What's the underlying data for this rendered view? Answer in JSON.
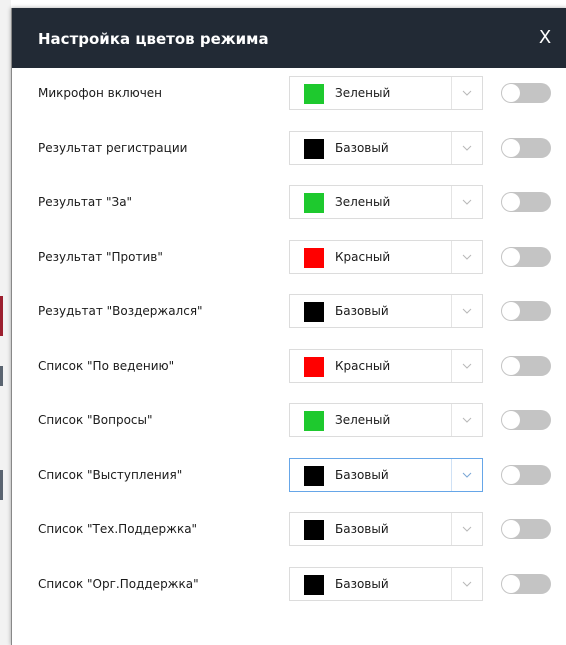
{
  "dialog": {
    "title": "Настройка цветов режима",
    "close_label": "X"
  },
  "colors": {
    "green": "#1ec92e",
    "black": "#000000",
    "red": "#ff0000",
    "header_bg": "#222a35",
    "focus_border": "#66a6e8",
    "toggle_off": "#c4c4c4"
  },
  "settings": [
    {
      "label": "Микрофон включен",
      "color_name": "Зеленый",
      "swatch": "#1ec92e",
      "focused": false,
      "enabled": false
    },
    {
      "label": "Результат регистрации",
      "color_name": "Базовый",
      "swatch": "#000000",
      "focused": false,
      "enabled": false
    },
    {
      "label": "Результат \"За\"",
      "color_name": "Зеленый",
      "swatch": "#1ec92e",
      "focused": false,
      "enabled": false
    },
    {
      "label": "Результат \"Против\"",
      "color_name": "Красный",
      "swatch": "#ff0000",
      "focused": false,
      "enabled": false
    },
    {
      "label": "Резудьтат \"Воздержался\"",
      "color_name": "Базовый",
      "swatch": "#000000",
      "focused": false,
      "enabled": false
    },
    {
      "label": "Список \"По ведению\"",
      "color_name": "Красный",
      "swatch": "#ff0000",
      "focused": false,
      "enabled": false
    },
    {
      "label": "Список \"Вопросы\"",
      "color_name": "Зеленый",
      "swatch": "#1ec92e",
      "focused": false,
      "enabled": false
    },
    {
      "label": "Список \"Выступления\"",
      "color_name": "Базовый",
      "swatch": "#000000",
      "focused": true,
      "enabled": false
    },
    {
      "label": "Список \"Тех.Поддержка\"",
      "color_name": "Базовый",
      "swatch": "#000000",
      "focused": false,
      "enabled": false
    },
    {
      "label": "Список \"Орг.Поддержка\"",
      "color_name": "Базовый",
      "swatch": "#000000",
      "focused": false,
      "enabled": false
    }
  ]
}
